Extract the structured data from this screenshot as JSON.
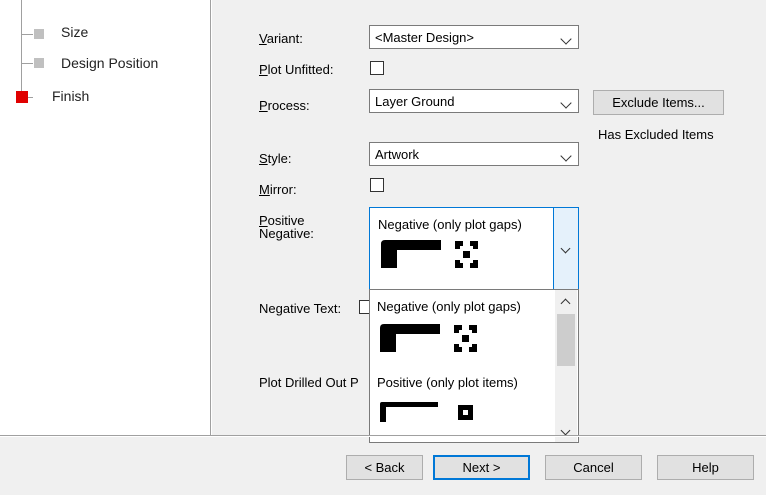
{
  "tree": {
    "items": [
      {
        "label": "Size"
      },
      {
        "label": "Design Position"
      },
      {
        "label": "Finish"
      }
    ],
    "active_color": "#e00000"
  },
  "form": {
    "variant": {
      "label": "Variant:",
      "value": "<Master Design>"
    },
    "plot_unfitted": {
      "label": "Plot Unfitted:",
      "checked": false
    },
    "process": {
      "label": "Process:",
      "value": "Layer Ground"
    },
    "exclude_items_button": "Exclude Items...",
    "has_excluded_items": "Has Excluded Items",
    "style": {
      "label": "Style:",
      "value": "Artwork"
    },
    "mirror": {
      "label": "Mirror:",
      "checked": false
    },
    "positive_negative": {
      "label_line1": "Positive",
      "label_line2": "Negative:",
      "value": "Negative (only plot gaps)"
    },
    "negative_text": {
      "label": "Negative Text:"
    },
    "plot_drilled_out": {
      "label": "Plot Drilled Out P"
    }
  },
  "dropdown": {
    "options": [
      {
        "label": "Negative (only plot gaps)"
      },
      {
        "label": "Positive (only plot items)"
      }
    ]
  },
  "buttons": {
    "back": "< Back",
    "next": "Next >",
    "cancel": "Cancel",
    "help": "Help"
  }
}
